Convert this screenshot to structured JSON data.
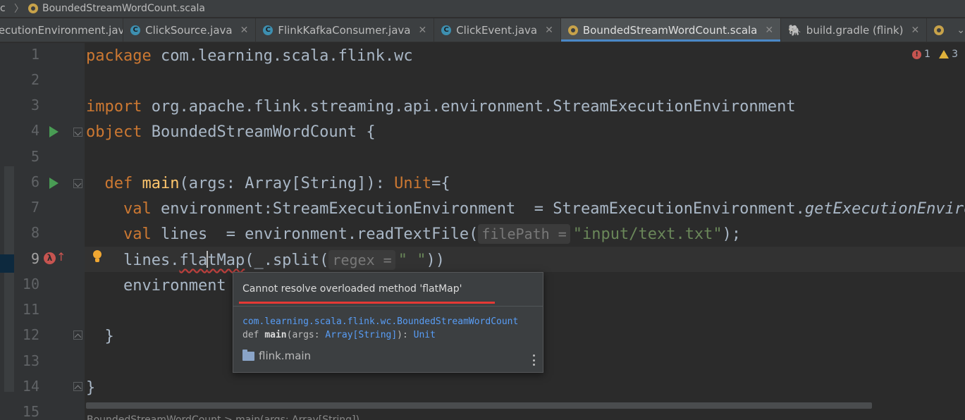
{
  "breadcrumb": {
    "prev": "c",
    "file": "BoundedStreamWordCount.scala"
  },
  "tabs": [
    {
      "label": "ExecutionEnvironment.java",
      "icon": "java-class-icon"
    },
    {
      "label": "ClickSource.java",
      "icon": "java-class-icon"
    },
    {
      "label": "FlinkKafkaConsumer.java",
      "icon": "java-class-icon"
    },
    {
      "label": "ClickEvent.java",
      "icon": "java-class-icon"
    },
    {
      "label": "BoundedStreamWordCount.scala",
      "icon": "scala-object-icon",
      "active": true
    },
    {
      "label": "build.gradle (flink)",
      "icon": "gradle-icon"
    }
  ],
  "indicators": {
    "errors": "1",
    "warnings": "3"
  },
  "line_numbers": [
    "1",
    "2",
    "3",
    "4",
    "5",
    "6",
    "7",
    "8",
    "9",
    "10",
    "11",
    "12",
    "13",
    "14",
    "15"
  ],
  "code": {
    "l1_kw": "package",
    "l1_rest": " com.learning.scala.flink.wc",
    "l3_kw": "import",
    "l3_rest": " org.apache.flink.streaming.api.environment.StreamExecutionEnvironment",
    "l4_kw": "object",
    "l4_rest": " BoundedStreamWordCount {",
    "l6_kw": "def",
    "l6_fn": "main",
    "l6_args": "(args: Array[String]): ",
    "l6_unit": "Unit",
    "l6_end": "={",
    "l7_kw": "val",
    "l7_rest": " environment:StreamExecutionEnvironment  = StreamExecutionEnvironment.",
    "l7_it": "getExecutionEnvironment",
    "l8_kw": "val",
    "l8_rest": " lines  = environment.readTextFile(",
    "l8_hint": "filePath =",
    "l8_str": "\"input/text.txt\"",
    "l8_end": ");",
    "l9_a": "lines.",
    "l9_b": "fla",
    "l9_c": "tMap",
    "l9_d": "(_.split(",
    "l9_hint": "regex =",
    "l9_str": "\" \"",
    "l9_end": "))",
    "l10": "environment",
    "l12": "}",
    "l14": "}"
  },
  "popup": {
    "message": "Cannot resolve overloaded method 'flatMap'",
    "qualified_name": "com.learning.scala.flink.wc.BoundedStreamWordCount",
    "sig_def": "def ",
    "sig_name": "main",
    "sig_open": "(args: ",
    "sig_type": "Array[String]",
    "sig_mid": "): ",
    "sig_ret": "Unit",
    "module": "flink.main"
  },
  "bottom_crumb": "BoundedStreamWordCount > main(args: Array[String])",
  "colors": {
    "keyword": "#cc7832",
    "function": "#ffc66d",
    "string": "#6a8759",
    "error": "#bc3f3c",
    "accent": "#4a88c7"
  }
}
